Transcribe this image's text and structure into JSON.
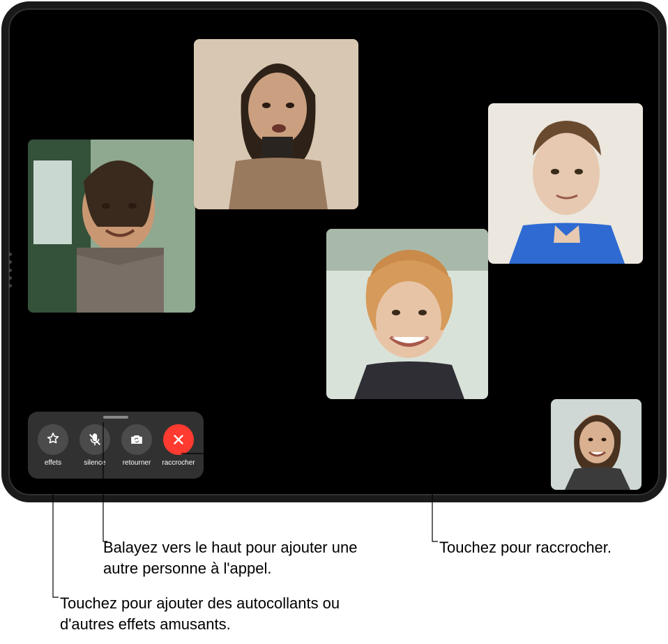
{
  "controls": {
    "effects_label": "effets",
    "mute_label": "silence",
    "flip_label": "retourner",
    "end_label": "raccrocher"
  },
  "callouts": {
    "swipe_up": "Balayez vers le haut pour ajouter une autre personne à l'appel.",
    "end_call": "Touchez pour raccrocher.",
    "effects": "Touchez pour ajouter des autocollants ou d'autres effets amusants."
  }
}
